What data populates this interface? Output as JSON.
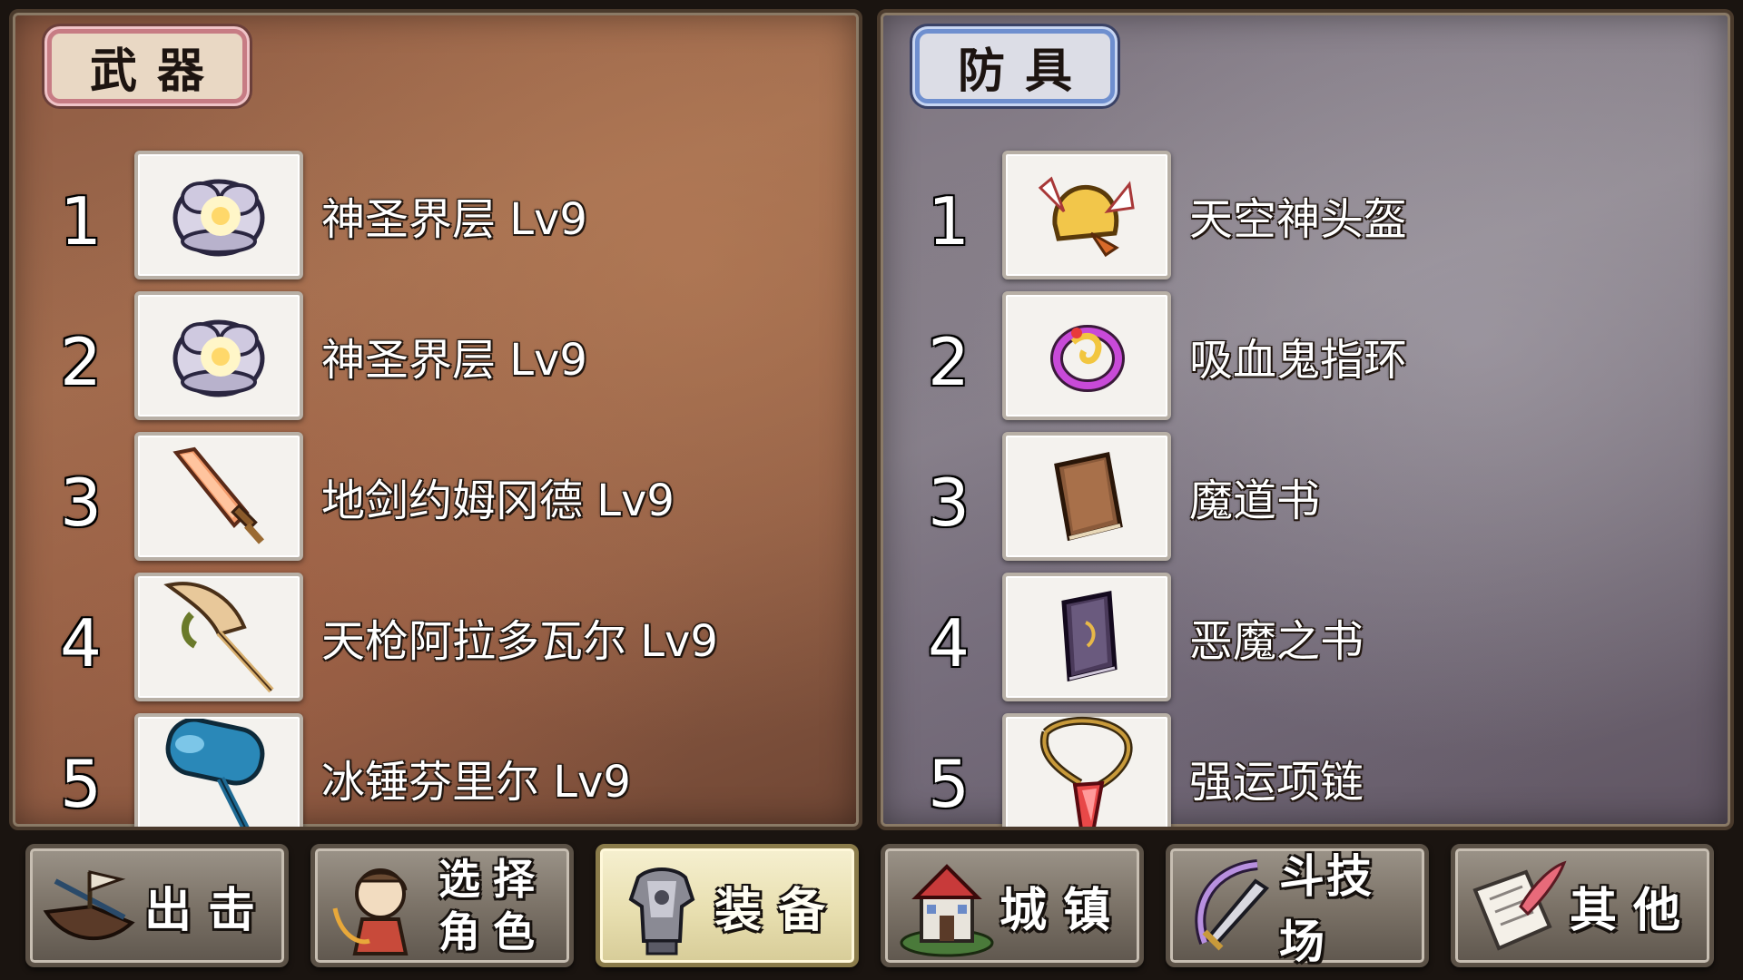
{
  "weapons": {
    "title": "武器",
    "items": [
      {
        "num": "1",
        "name": "神圣界层 Lv9",
        "icon": "holy-orb-icon"
      },
      {
        "num": "2",
        "name": "神圣界层 Lv9",
        "icon": "holy-orb-icon"
      },
      {
        "num": "3",
        "name": "地剑约姆冈德 Lv9",
        "icon": "earth-sword-icon"
      },
      {
        "num": "4",
        "name": "天枪阿拉多瓦尔 Lv9",
        "icon": "sky-spear-icon"
      },
      {
        "num": "5",
        "name": "冰锤芬里尔 Lv9",
        "icon": "ice-hammer-icon"
      }
    ]
  },
  "armor": {
    "title": "防具",
    "items": [
      {
        "num": "1",
        "name": "天空神头盔",
        "icon": "winged-helmet-icon"
      },
      {
        "num": "2",
        "name": "吸血鬼指环",
        "icon": "vampire-ring-icon"
      },
      {
        "num": "3",
        "name": "魔道书",
        "icon": "magic-book-icon"
      },
      {
        "num": "4",
        "name": "恶魔之书",
        "icon": "demon-book-icon"
      },
      {
        "num": "5",
        "name": "强运项链",
        "icon": "luck-necklace-icon"
      }
    ]
  },
  "nav": {
    "sortie": "出击",
    "select_line1": "选择",
    "select_line2": "角色",
    "equip": "装备",
    "town": "城镇",
    "arena": "斗技场",
    "other": "其他",
    "active": "equip"
  }
}
